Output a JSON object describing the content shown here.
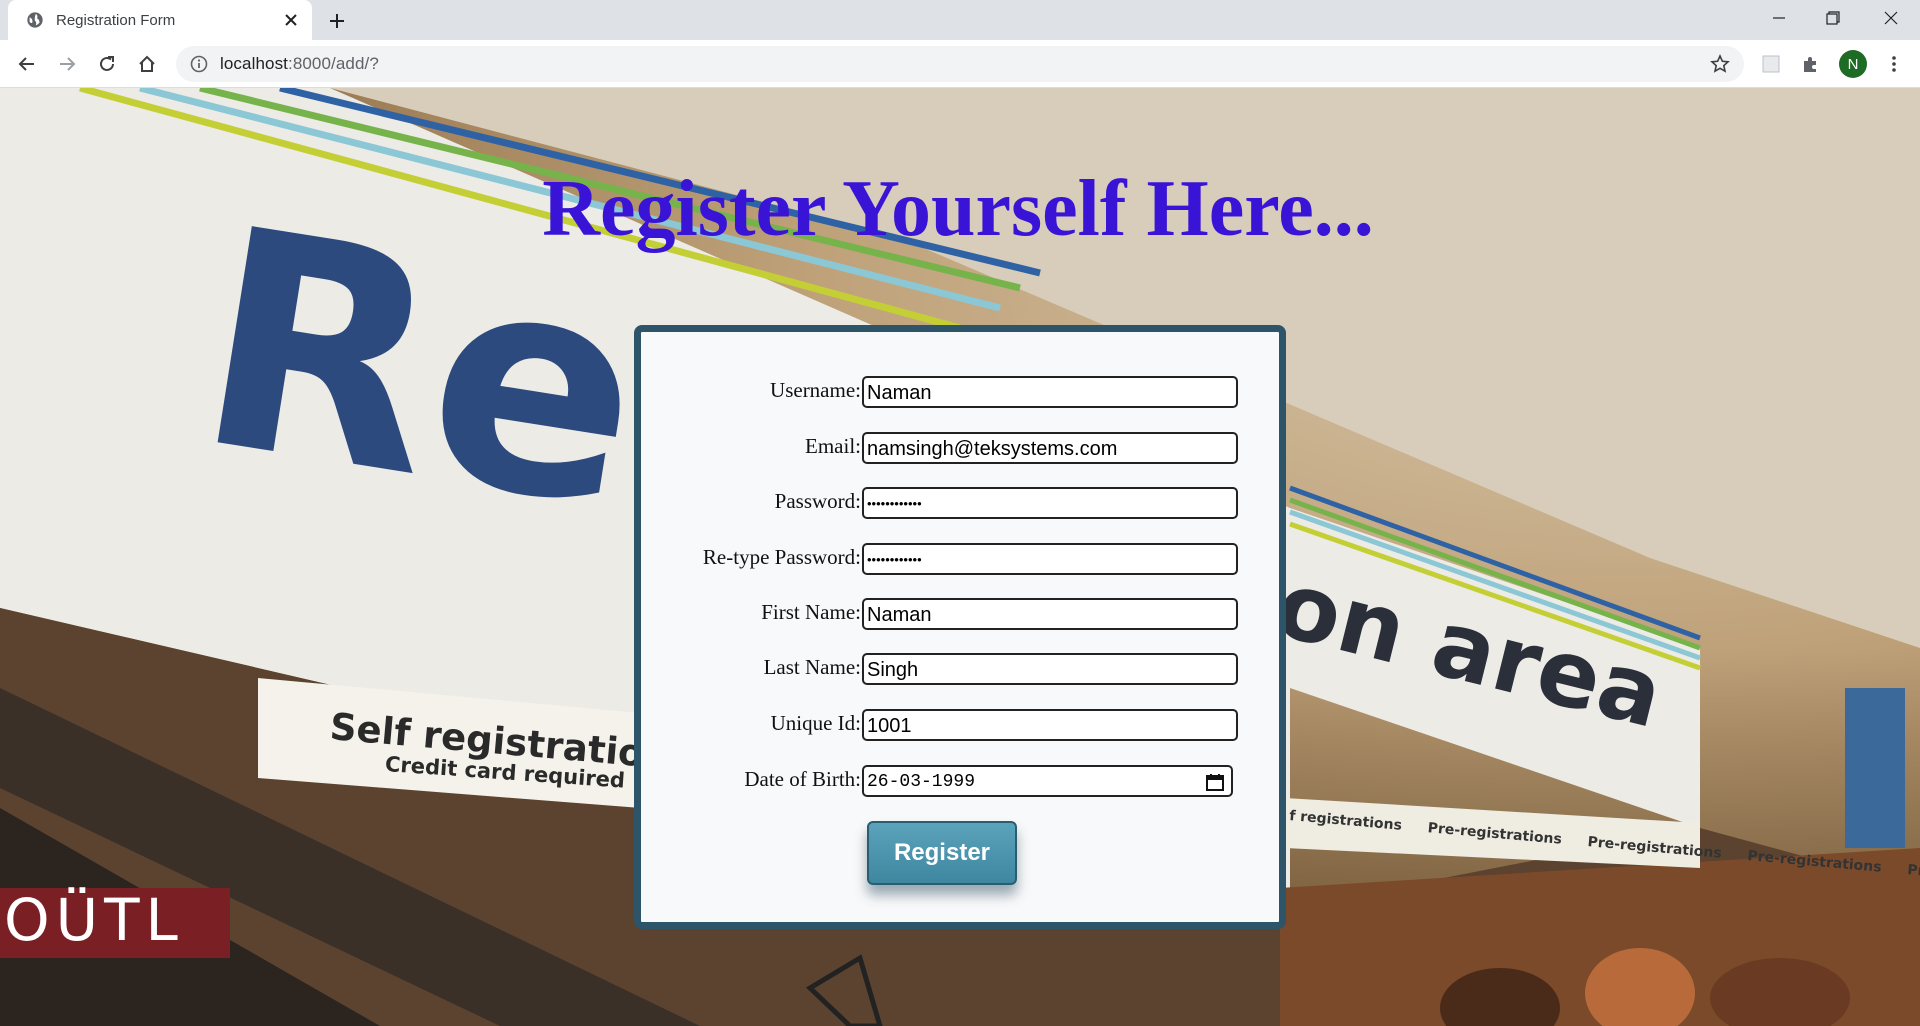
{
  "browser": {
    "tab_title": "Registration Form",
    "url_host": "localhost",
    "url_rest": ":8000/add/?",
    "profile_initial": "N"
  },
  "page": {
    "heading": "Register Yourself Here...",
    "background_text": {
      "big_letters": "Re",
      "area": "on area",
      "self_reg": "Self registrations",
      "credit": "Credit card required",
      "outlet": "OÜTL",
      "small_signs": [
        "f registrations",
        "Pre-registrations",
        "Pre-registrations",
        "Pre-registrations",
        "Pre-registrations"
      ]
    },
    "form": {
      "fields": [
        {
          "label": "Username:",
          "value": "Naman"
        },
        {
          "label": "Email:",
          "value": "namsingh@teksystems.com"
        },
        {
          "label": "Password:",
          "value": "••••••••••••"
        },
        {
          "label": "Re-type Password:",
          "value": "••••••••••••"
        },
        {
          "label": "First Name:",
          "value": "Naman"
        },
        {
          "label": "Last Name:",
          "value": "Singh"
        },
        {
          "label": "Unique Id:",
          "value": "1001"
        },
        {
          "label": "Date of Birth:",
          "value": "26-03-1999"
        }
      ],
      "submit_label": "Register"
    }
  },
  "colors": {
    "heading": "#3a14d6",
    "card_border": "#2d5468",
    "button": "#4a93ad"
  }
}
